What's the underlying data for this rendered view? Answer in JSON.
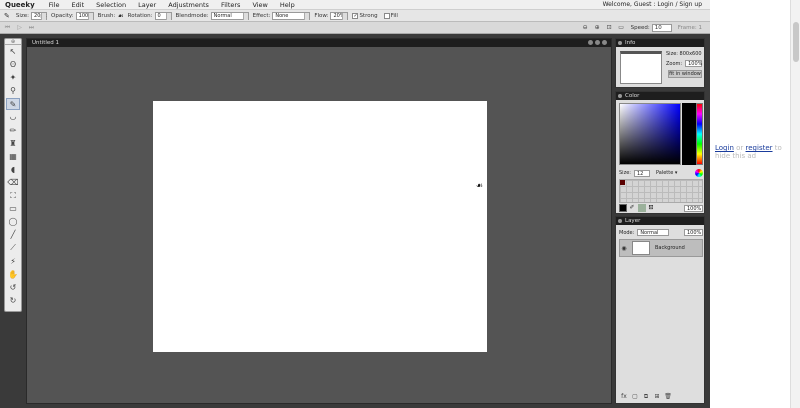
{
  "app": {
    "brand": "Queeky"
  },
  "menu": [
    "File",
    "Edit",
    "Selection",
    "Layer",
    "Adjustments",
    "Filters",
    "View",
    "Help"
  ],
  "user": {
    "welcome": "Welcome, Guest :",
    "login": "Login",
    "separator": "/",
    "signup": "Sign up"
  },
  "options": {
    "size_label": "Size:",
    "size_value": "20px",
    "opacity_label": "Opacity:",
    "opacity_value": "100%",
    "brush_label": "Brush:",
    "rotation_label": "Rotation:",
    "rotation_value": "0",
    "blendmode_label": "Blendmode:",
    "blendmode_value": "Normal",
    "effect_label": "Effect:",
    "effect_value": "None",
    "flow_label": "Flow:",
    "flow_value": "20%",
    "strong_label": "Strong",
    "strong_checked": true,
    "fill_label": "Fill",
    "fill_checked": false
  },
  "subbar": {
    "speed_label": "Speed:",
    "speed_value": "10",
    "frame_label": "Frame: 1"
  },
  "tools": [
    {
      "name": "move-tool-icon",
      "glyph": "↖"
    },
    {
      "name": "lasso-tool-icon",
      "glyph": "ʘ"
    },
    {
      "name": "magic-wand-tool-icon",
      "glyph": "✦"
    },
    {
      "name": "zoom-tool-icon",
      "glyph": "⚲"
    },
    {
      "name": "brush-tool-icon",
      "glyph": "✎",
      "active": true
    },
    {
      "name": "smudge-tool-icon",
      "glyph": "◡"
    },
    {
      "name": "pencil-tool-icon",
      "glyph": "✏"
    },
    {
      "name": "stamp-tool-icon",
      "glyph": "♜"
    },
    {
      "name": "blur-tool-icon",
      "glyph": "▦"
    },
    {
      "name": "dodge-tool-icon",
      "glyph": "◖"
    },
    {
      "name": "eraser-tool-icon",
      "glyph": "⌫"
    },
    {
      "name": "bucket-tool-icon",
      "glyph": "⛶"
    },
    {
      "name": "rectangle-tool-icon",
      "glyph": "▭"
    },
    {
      "name": "ellipse-tool-icon",
      "glyph": "◯"
    },
    {
      "name": "line-tool-icon",
      "glyph": "╱"
    },
    {
      "name": "picker-tool-icon",
      "glyph": "⟋"
    },
    {
      "name": "gradient-tool-icon",
      "glyph": "⚡"
    },
    {
      "name": "hand-tool-icon",
      "glyph": "✋"
    },
    {
      "name": "undo-tool-icon",
      "glyph": "↺"
    },
    {
      "name": "redo-tool-icon",
      "glyph": "↻"
    }
  ],
  "document": {
    "title": "Untitled 1"
  },
  "info": {
    "title": "Info",
    "size_text": "Size: 800x600",
    "zoom_label": "Zoom:",
    "zoom_value": "100%",
    "fit_label": "fit in window"
  },
  "color": {
    "title": "Color",
    "size_label": "Size:",
    "size_value": "12",
    "palette_label": "Palette",
    "opacity_value": "100%",
    "fg_color": "#000000",
    "bg_color": "#9bb19b"
  },
  "layer": {
    "title": "Layer",
    "mode_label": "Mode:",
    "mode_value": "Normal",
    "opacity_value": "100%",
    "layers": [
      {
        "name": "Background"
      }
    ]
  },
  "ad": {
    "login": "Login",
    "or": "or",
    "register": "register",
    "tail": "to hide this ad"
  }
}
